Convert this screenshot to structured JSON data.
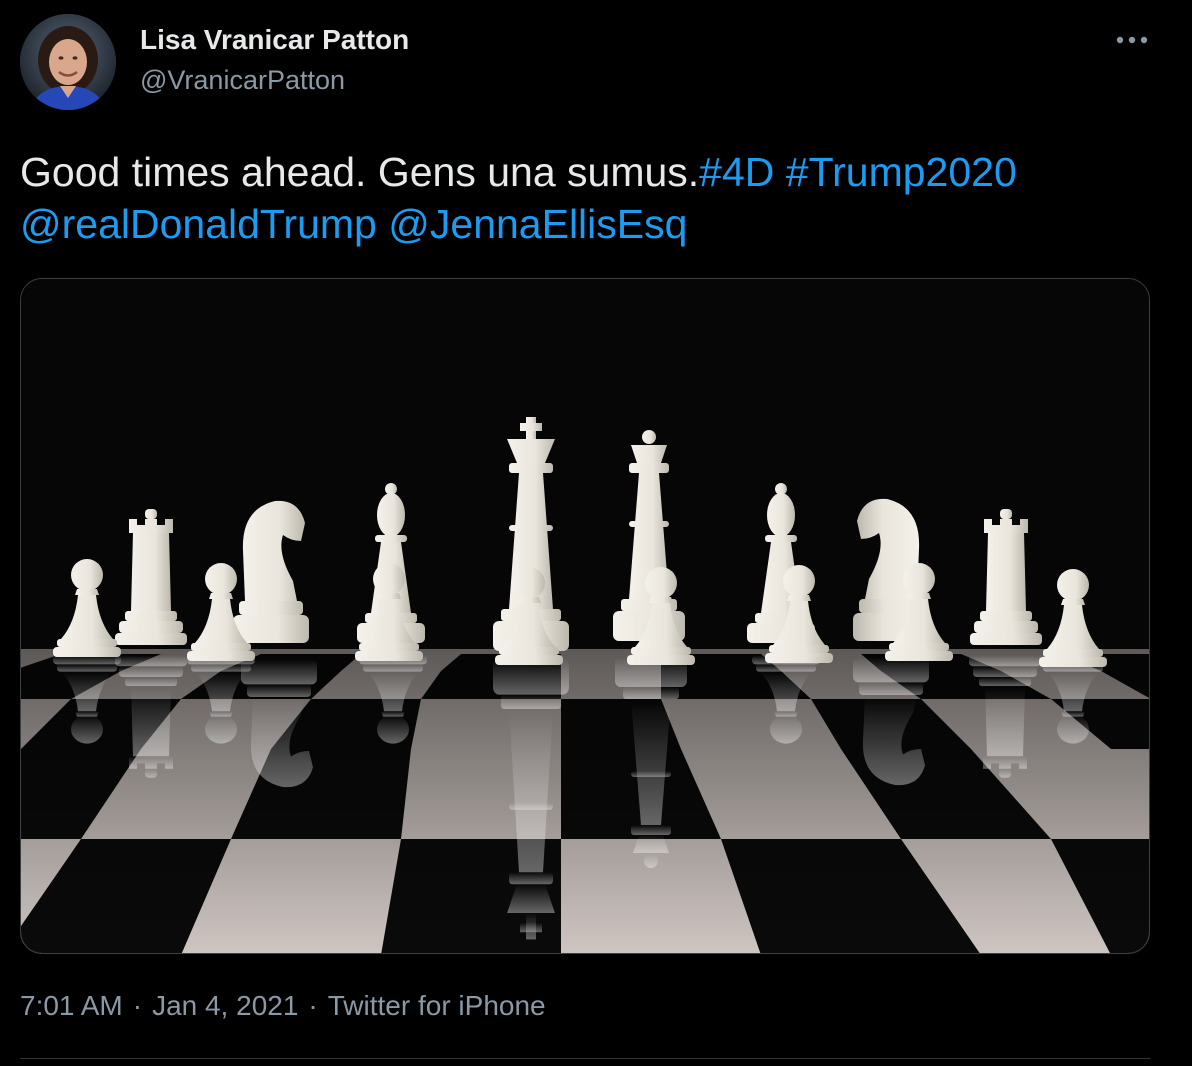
{
  "author": {
    "display_name": "Lisa Vranicar Patton",
    "handle": "@VranicarPatton"
  },
  "tweet": {
    "text": "Good times ahead. Gens una sumus.",
    "links": [
      "#4D",
      "#Trump2020",
      "@realDonaldTrump",
      "@JennaEllisEsq"
    ]
  },
  "media": {
    "icon": "chess-photo"
  },
  "meta": {
    "time": "7:01 AM",
    "date": "Jan 4, 2021",
    "source": "Twitter for iPhone",
    "separator": "·"
  },
  "colors": {
    "background": "#000000",
    "text": "#e7e9ea",
    "secondary": "#8b98a5",
    "link": "#1d9bf0"
  }
}
